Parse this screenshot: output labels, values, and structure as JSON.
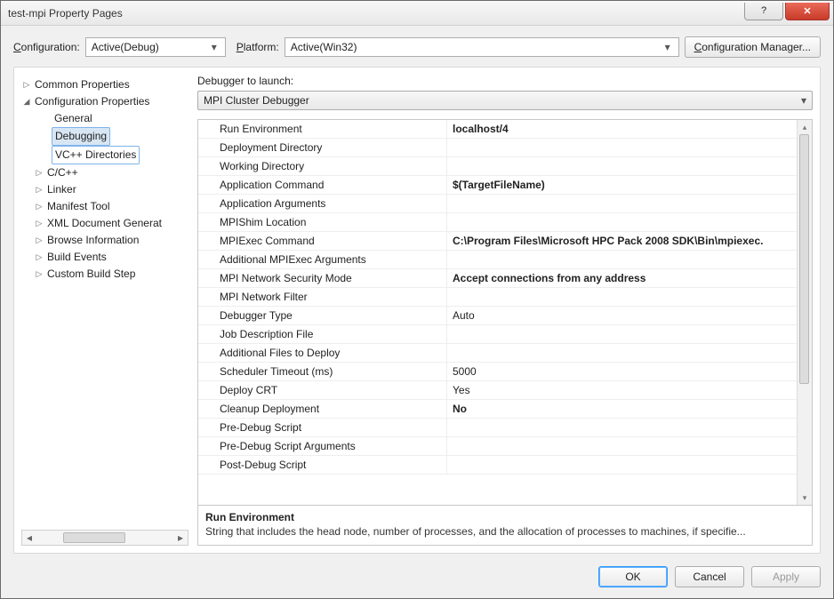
{
  "window": {
    "title": "test-mpi Property Pages"
  },
  "toolbar": {
    "config_label": "Configuration:",
    "config_value": "Active(Debug)",
    "platform_label": "Platform:",
    "platform_value": "Active(Win32)",
    "config_manager": "Configuration Manager..."
  },
  "tree": {
    "common": "Common Properties",
    "confprop": "Configuration Properties",
    "children": {
      "general": "General",
      "debugging": "Debugging",
      "vcdir": "VC++ Directories",
      "ccpp": "C/C++",
      "linker": "Linker",
      "manifest": "Manifest Tool",
      "xml": "XML Document Generat",
      "browse": "Browse Information",
      "build": "Build Events",
      "custom": "Custom Build Step"
    }
  },
  "launcher": {
    "label": "Debugger to launch:",
    "value": "MPI Cluster Debugger"
  },
  "grid": [
    {
      "name": "Run Environment",
      "value": "localhost/4",
      "bold": true
    },
    {
      "name": "Deployment Directory",
      "value": "",
      "bold": false
    },
    {
      "name": "Working Directory",
      "value": "",
      "bold": false
    },
    {
      "name": "Application Command",
      "value": "$(TargetFileName)",
      "bold": true
    },
    {
      "name": "Application Arguments",
      "value": "",
      "bold": false
    },
    {
      "name": "MPIShim Location",
      "value": "",
      "bold": false
    },
    {
      "name": "MPIExec Command",
      "value": "C:\\Program Files\\Microsoft HPC Pack 2008 SDK\\Bin\\mpiexec.",
      "bold": true
    },
    {
      "name": "Additional MPIExec Arguments",
      "value": "",
      "bold": false
    },
    {
      "name": "MPI Network Security Mode",
      "value": "Accept connections from any address",
      "bold": true
    },
    {
      "name": "MPI Network Filter",
      "value": "",
      "bold": false
    },
    {
      "name": "Debugger Type",
      "value": "Auto",
      "bold": false
    },
    {
      "name": "Job Description File",
      "value": "",
      "bold": false
    },
    {
      "name": "Additional Files to Deploy",
      "value": "",
      "bold": false
    },
    {
      "name": "Scheduler Timeout (ms)",
      "value": "5000",
      "bold": false
    },
    {
      "name": "Deploy CRT",
      "value": "Yes",
      "bold": false
    },
    {
      "name": "Cleanup Deployment",
      "value": "No",
      "bold": true
    },
    {
      "name": "Pre-Debug Script",
      "value": "",
      "bold": false
    },
    {
      "name": "Pre-Debug Script Arguments",
      "value": "",
      "bold": false
    },
    {
      "name": "Post-Debug Script",
      "value": "",
      "bold": false
    }
  ],
  "desc": {
    "title": "Run Environment",
    "text": "String that includes the head node, number of processes, and the allocation of processes to machines, if specifie..."
  },
  "buttons": {
    "ok": "OK",
    "cancel": "Cancel",
    "apply": "Apply"
  }
}
